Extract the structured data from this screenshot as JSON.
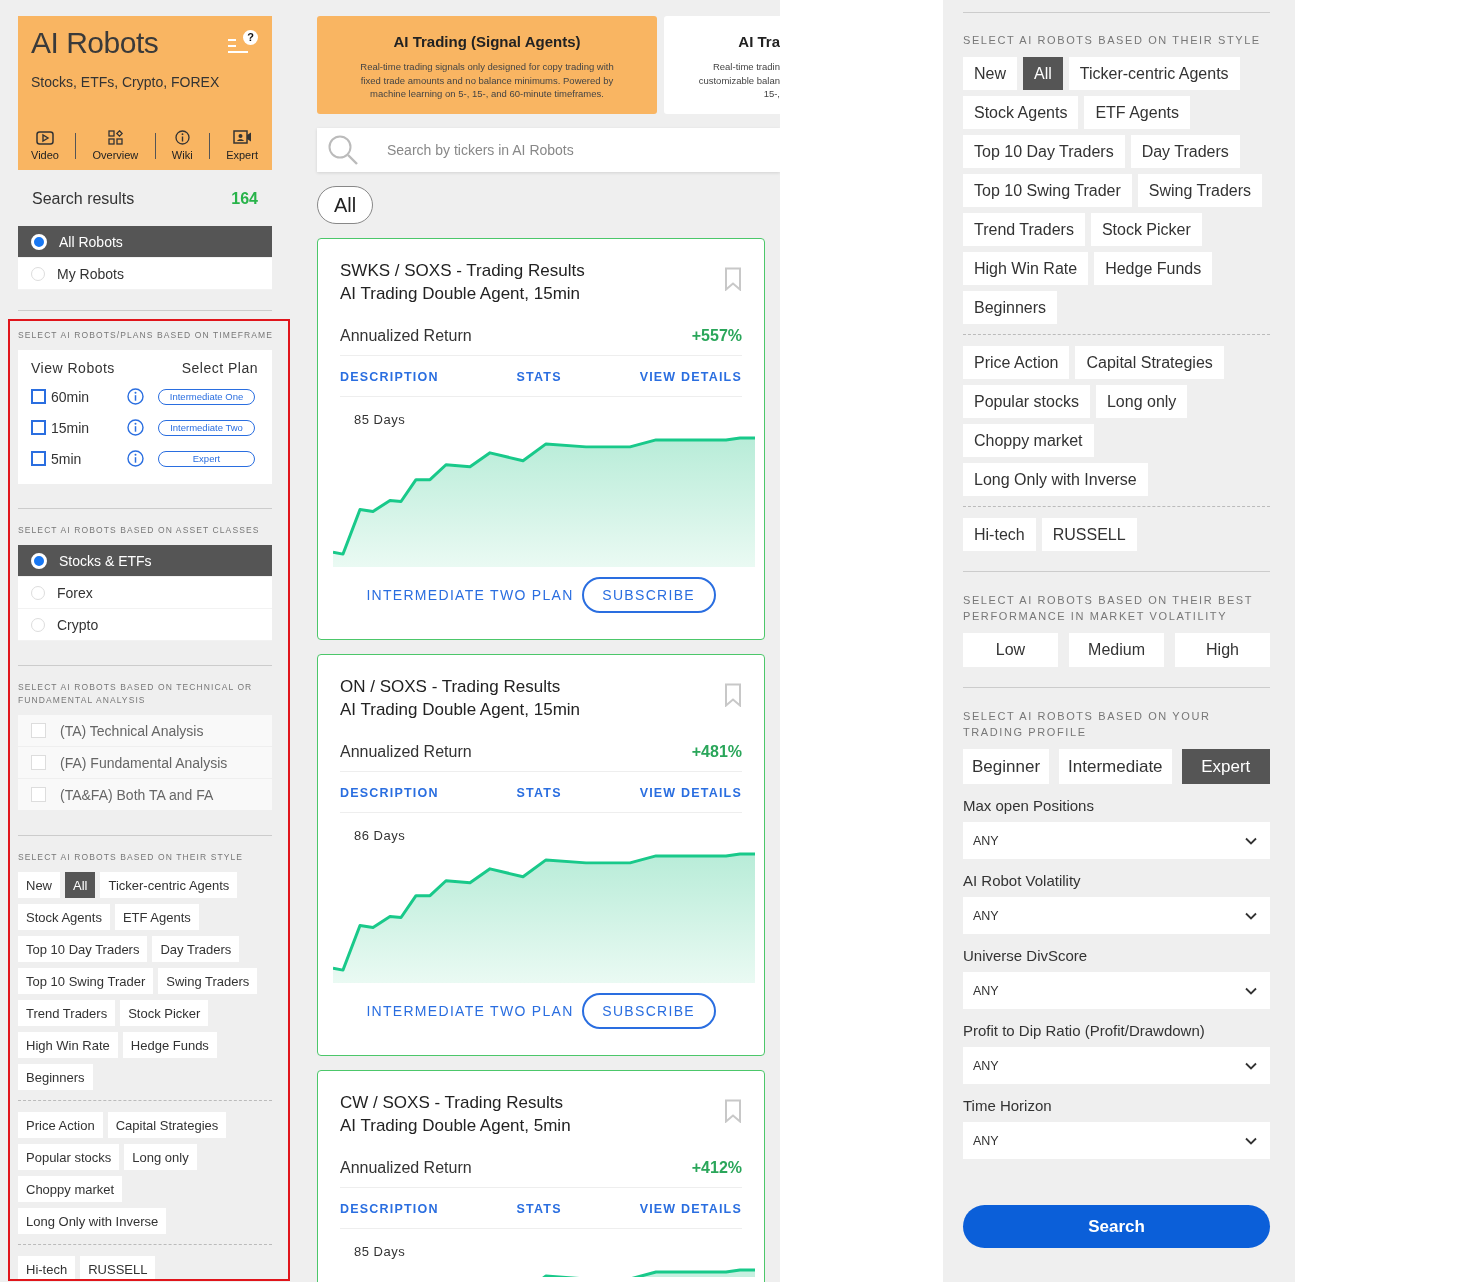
{
  "sidebar": {
    "header": {
      "title": "AI Robots",
      "subtitle": "Stocks, ETFs, Crypto, FOREX",
      "help_mark": "?",
      "nav": [
        {
          "label": "Video",
          "kind": "video"
        },
        {
          "label": "Overview",
          "kind": "overview"
        },
        {
          "label": "Wiki",
          "kind": "wiki"
        },
        {
          "label": "Expert",
          "kind": "expert"
        }
      ]
    },
    "results": {
      "label": "Search results",
      "count": "164"
    },
    "robot_filter": [
      {
        "label": "All Robots",
        "selected": true
      },
      {
        "label": "My Robots",
        "selected": false
      }
    ],
    "timeframe": {
      "heading": "SELECT AI ROBOTS/PLANS BASED ON TIMEFRAME",
      "column_1": "View Robots",
      "column_2": "Select Plan",
      "rows": [
        {
          "label": "60min",
          "checked": false,
          "plan": "Intermediate One"
        },
        {
          "label": "15min",
          "checked": false,
          "plan": "Intermediate Two"
        },
        {
          "label": "5min",
          "checked": false,
          "plan": "Expert"
        }
      ]
    },
    "asset_classes": {
      "heading": "SELECT AI ROBOTS BASED ON ASSET CLASSES",
      "options": [
        {
          "label": "Stocks & ETFs",
          "selected": true
        },
        {
          "label": "Forex",
          "selected": false
        },
        {
          "label": "Crypto",
          "selected": false
        }
      ]
    },
    "analysis": {
      "heading": "SELECT AI ROBOTS BASED ON TECHNICAL OR FUNDAMENTAL ANALYSIS",
      "options": [
        {
          "label": "(TA) Technical Analysis",
          "checked": false
        },
        {
          "label": "(FA) Fundamental Analysis",
          "checked": false
        },
        {
          "label": "(TA&FA) Both TA and FA",
          "checked": false
        }
      ]
    },
    "style": {
      "heading": "SELECT AI ROBOTS BASED ON THEIR STYLE",
      "groups": [
        {
          "chips": [
            {
              "label": "New",
              "selected": false
            },
            {
              "label": "All",
              "selected": true
            },
            {
              "label": "Ticker-centric Agents",
              "selected": false
            },
            {
              "label": "Stock Agents",
              "selected": false
            },
            {
              "label": "ETF Agents",
              "selected": false
            },
            {
              "label": "Top 10 Day Traders",
              "selected": false
            },
            {
              "label": "Day Traders",
              "selected": false
            },
            {
              "label": "Top 10 Swing Trader",
              "selected": false
            },
            {
              "label": "Swing Traders",
              "selected": false
            },
            {
              "label": "Trend Traders",
              "selected": false
            },
            {
              "label": "Stock Picker",
              "selected": false
            },
            {
              "label": "High Win Rate",
              "selected": false
            },
            {
              "label": "Hedge Funds",
              "selected": false
            },
            {
              "label": "Beginners",
              "selected": false
            }
          ]
        },
        {
          "chips": [
            {
              "label": "Price Action",
              "selected": false
            },
            {
              "label": "Capital Strategies",
              "selected": false
            },
            {
              "label": "Popular stocks",
              "selected": false
            },
            {
              "label": "Long only",
              "selected": false
            },
            {
              "label": "Choppy market",
              "selected": false
            },
            {
              "label": "Long Only with Inverse",
              "selected": false
            }
          ]
        },
        {
          "chips": [
            {
              "label": "Hi-tech",
              "selected": false
            },
            {
              "label": "RUSSELL",
              "selected": false
            }
          ]
        }
      ]
    }
  },
  "main": {
    "plans": [
      {
        "title": "AI Trading (Signal Agents)",
        "lines": [
          "Real-time trading signals only designed for copy trading with",
          "fixed trade amounts and no balance minimums. Powered by",
          "machine learning on 5-, 15-, and 60-minute timeframes."
        ],
        "selected": true
      },
      {
        "title": "AI Tra",
        "lines": [
          "Real-time tradin",
          "customizable balan",
          "15-,"
        ],
        "selected": false
      }
    ],
    "search": {
      "placeholder": "Search by tickers in AI Robots"
    },
    "filter_pill": "All",
    "cards": [
      {
        "title": "SWKS / SOXS - Trading Results",
        "subtitle": "AI Trading Double Agent, 15min",
        "metric_label": "Annualized Return",
        "metric_value": "+557%",
        "tabs": [
          "DESCRIPTION",
          "STATS",
          "VIEW DETAILS"
        ],
        "days": "85 Days",
        "plan_link": "INTERMEDIATE TWO PLAN",
        "action": "SUBSCRIBE"
      },
      {
        "title": "ON / SOXS - Trading Results",
        "subtitle": "AI Trading Double Agent, 15min",
        "metric_label": "Annualized Return",
        "metric_value": "+481%",
        "tabs": [
          "DESCRIPTION",
          "STATS",
          "VIEW DETAILS"
        ],
        "days": "86 Days",
        "plan_link": "INTERMEDIATE TWO PLAN",
        "action": "SUBSCRIBE"
      },
      {
        "title": "CW / SOXS - Trading Results",
        "subtitle": "AI Trading Double Agent, 5min",
        "metric_label": "Annualized Return",
        "metric_value": "+412%",
        "tabs": [
          "DESCRIPTION",
          "STATS",
          "VIEW DETAILS"
        ],
        "days": "85 Days"
      }
    ]
  },
  "filters": {
    "style": {
      "heading": "SELECT AI ROBOTS BASED ON THEIR STYLE",
      "groups": [
        {
          "chips": [
            {
              "label": "New",
              "selected": false
            },
            {
              "label": "All",
              "selected": true
            },
            {
              "label": "Ticker-centric Agents",
              "selected": false
            },
            {
              "label": "Stock Agents",
              "selected": false
            },
            {
              "label": "ETF Agents",
              "selected": false
            },
            {
              "label": "Top 10 Day Traders",
              "selected": false
            },
            {
              "label": "Day Traders",
              "selected": false
            },
            {
              "label": "Top 10 Swing Trader",
              "selected": false
            },
            {
              "label": "Swing Traders",
              "selected": false
            },
            {
              "label": "Trend Traders",
              "selected": false
            },
            {
              "label": "Stock Picker",
              "selected": false
            },
            {
              "label": "High Win Rate",
              "selected": false
            },
            {
              "label": "Hedge Funds",
              "selected": false
            },
            {
              "label": "Beginners",
              "selected": false
            }
          ]
        },
        {
          "chips": [
            {
              "label": "Price Action",
              "selected": false
            },
            {
              "label": "Capital Strategies",
              "selected": false
            },
            {
              "label": "Popular stocks",
              "selected": false
            },
            {
              "label": "Long only",
              "selected": false
            },
            {
              "label": "Choppy market",
              "selected": false
            },
            {
              "label": "Long Only with Inverse",
              "selected": false
            }
          ]
        },
        {
          "chips": [
            {
              "label": "Hi-tech",
              "selected": false
            },
            {
              "label": "RUSSELL",
              "selected": false
            }
          ]
        }
      ]
    },
    "volatility": {
      "heading": "SELECT AI ROBOTS BASED ON THEIR BEST PERFORMANCE IN MARKET VOLATILITY",
      "options": [
        {
          "label": "Low",
          "selected": false
        },
        {
          "label": "Medium",
          "selected": false
        },
        {
          "label": "High",
          "selected": false
        }
      ]
    },
    "profile": {
      "heading": "SELECT AI ROBOTS BASED ON YOUR TRADING PROFILE",
      "options": [
        {
          "label": "Beginner",
          "selected": false
        },
        {
          "label": "Intermediate",
          "selected": false
        },
        {
          "label": "Expert",
          "selected": true
        }
      ]
    },
    "dropdowns": [
      {
        "label": "Max open Positions",
        "value": "ANY"
      },
      {
        "label": "AI Robot Volatility",
        "value": "ANY"
      },
      {
        "label": "Universe DivScore",
        "value": "ANY"
      },
      {
        "label": "Profit to Dip Ratio (Profit/Drawdown)",
        "value": "ANY"
      },
      {
        "label": "Time Horizon",
        "value": "ANY"
      }
    ],
    "search_button": "Search"
  }
}
